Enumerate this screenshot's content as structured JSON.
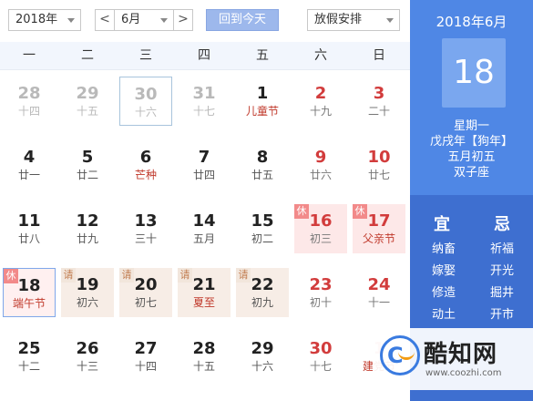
{
  "toolbar": {
    "year_value": "2018年",
    "prev_symbol": "<",
    "month_value": "6月",
    "next_symbol": ">",
    "today_label": "回到今天",
    "holiday_value": "放假安排"
  },
  "weekdays": [
    "一",
    "二",
    "三",
    "四",
    "五",
    "六",
    "日"
  ],
  "days": [
    {
      "n": "28",
      "l": "十四",
      "other": true
    },
    {
      "n": "29",
      "l": "十五",
      "other": true
    },
    {
      "n": "30",
      "l": "十六",
      "other": true,
      "selected": true
    },
    {
      "n": "31",
      "l": "十七",
      "other": true
    },
    {
      "n": "1",
      "l": "儿童节",
      "festival": true
    },
    {
      "n": "2",
      "l": "十九",
      "wknd": true
    },
    {
      "n": "3",
      "l": "二十",
      "wknd": true
    },
    {
      "n": "4",
      "l": "廿一"
    },
    {
      "n": "5",
      "l": "廿二"
    },
    {
      "n": "6",
      "l": "芒种",
      "festival": true
    },
    {
      "n": "7",
      "l": "廿四"
    },
    {
      "n": "8",
      "l": "廿五"
    },
    {
      "n": "9",
      "l": "廿六",
      "wknd": true
    },
    {
      "n": "10",
      "l": "廿七",
      "wknd": true
    },
    {
      "n": "11",
      "l": "廿八"
    },
    {
      "n": "12",
      "l": "廿九"
    },
    {
      "n": "13",
      "l": "三十"
    },
    {
      "n": "14",
      "l": "五月"
    },
    {
      "n": "15",
      "l": "初二"
    },
    {
      "n": "16",
      "l": "初三",
      "wknd": true,
      "holiday": true,
      "tag": "休"
    },
    {
      "n": "17",
      "l": "父亲节",
      "wknd": true,
      "holiday": true,
      "festival": true,
      "tag": "休"
    },
    {
      "n": "18",
      "l": "端午节",
      "today": true,
      "festival": true,
      "tag": "休"
    },
    {
      "n": "19",
      "l": "初六",
      "workday": true,
      "tag": "请"
    },
    {
      "n": "20",
      "l": "初七",
      "workday": true,
      "tag": "请"
    },
    {
      "n": "21",
      "l": "夏至",
      "workday": true,
      "festival": true,
      "tag": "请"
    },
    {
      "n": "22",
      "l": "初九",
      "workday": true,
      "tag": "请"
    },
    {
      "n": "23",
      "l": "初十",
      "wknd": true
    },
    {
      "n": "24",
      "l": "十一",
      "wknd": true
    },
    {
      "n": "25",
      "l": "十二"
    },
    {
      "n": "26",
      "l": "十三"
    },
    {
      "n": "27",
      "l": "十四"
    },
    {
      "n": "28",
      "l": "十五"
    },
    {
      "n": "29",
      "l": "十六"
    },
    {
      "n": "30",
      "l": "十七",
      "wknd": true
    },
    {
      "n": "1",
      "l": "建党节",
      "other": true,
      "wknd": true,
      "festival": true
    }
  ],
  "side": {
    "year_month": "2018年6月",
    "big_day": "18",
    "weekday": "星期一",
    "ganzhi": "戊戌年【狗年】",
    "lunar": "五月初五",
    "zodiac": "双子座",
    "yi_label": "宜",
    "ji_label": "忌",
    "yi_items": [
      "纳畜",
      "嫁娶",
      "修造",
      "动土"
    ],
    "ji_items": [
      "祈福",
      "开光",
      "掘井",
      "开市"
    ]
  },
  "watermark": {
    "name": "酷知网",
    "url": "www.coozhi.com"
  },
  "colors": {
    "panel": "#4f87e5",
    "accent": "#9db8ec",
    "weekend": "#d23c3c"
  }
}
